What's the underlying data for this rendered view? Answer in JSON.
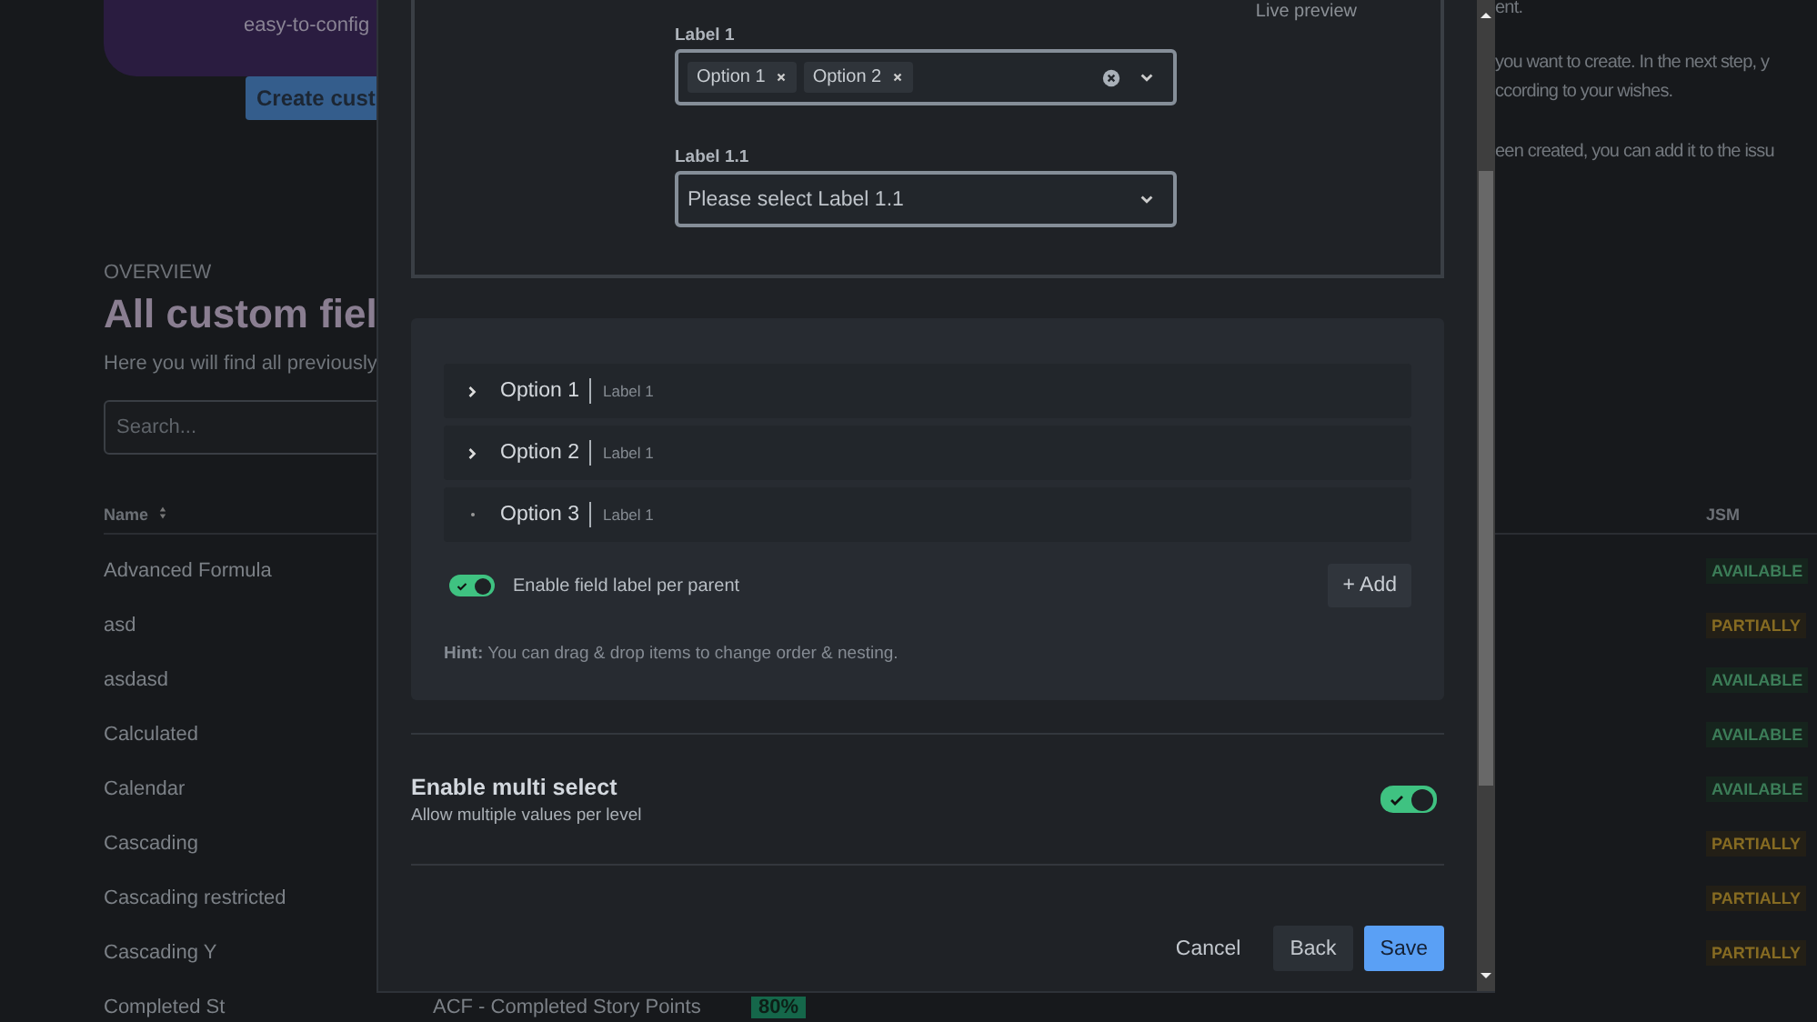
{
  "background": {
    "hero_text": "easy-to-config",
    "create_button": "Create cust",
    "intro_lines": [
      "ent.",
      "you want to create. In the next step, y",
      "ccording to your wishes.",
      "een created, you can add it to the issu"
    ],
    "overview": {
      "eyebrow": "OVERVIEW",
      "title": "All custom fiel",
      "description": "Here you will find all previously",
      "search": {
        "placeholder": "Search..."
      }
    },
    "table": {
      "columns": [
        {
          "label": "Name",
          "sortable": true
        },
        {
          "label": "JSM",
          "sortable": false
        }
      ],
      "rows": [
        {
          "name": "Advanced Formula",
          "jsm": {
            "label": "AVAILABLE",
            "kind": "available"
          }
        },
        {
          "name": "asd",
          "jsm": {
            "label": "PARTIALLY",
            "kind": "partial"
          }
        },
        {
          "name": "asdasd",
          "jsm": {
            "label": "AVAILABLE",
            "kind": "available"
          }
        },
        {
          "name": "Calculated",
          "jsm": {
            "label": "AVAILABLE",
            "kind": "available"
          }
        },
        {
          "name": "Calendar",
          "jsm": {
            "label": "AVAILABLE",
            "kind": "available"
          }
        },
        {
          "name": "Cascading",
          "jsm": {
            "label": "PARTIALLY",
            "kind": "partial"
          }
        },
        {
          "name": "Cascading restricted",
          "jsm": {
            "label": "PARTIALLY",
            "kind": "partial"
          }
        },
        {
          "name": "Cascading Y",
          "jsm": {
            "label": "PARTIALLY",
            "kind": "partial"
          }
        },
        {
          "name": "Completed St",
          "column_2": "ACF - Completed Story Points",
          "column_3": "80%"
        }
      ]
    }
  },
  "modal": {
    "live_preview": "Live preview",
    "fields": [
      {
        "label": "Label 1",
        "kind": "multi",
        "chips": [
          "Option 1",
          "Option 2"
        ]
      },
      {
        "label": "Label 1.1",
        "kind": "single",
        "placeholder": "Please select Label 1.1"
      }
    ],
    "tree": {
      "items": [
        {
          "label": "Option 1",
          "tag": "Label 1",
          "expandable": true
        },
        {
          "label": "Option 2",
          "tag": "Label 1",
          "expandable": true
        },
        {
          "label": "Option 3",
          "tag": "Label 1",
          "expandable": false
        }
      ],
      "toggle": {
        "label": "Enable field label per parent",
        "on": true
      },
      "add_button": "+ Add",
      "hint": "**Hint:** You can drag & drop items to change order & nesting."
    },
    "setting": {
      "title": "Enable multi select",
      "description": "Allow multiple values per level",
      "on": true
    },
    "buttons": [
      {
        "label": "Cancel",
        "kind": "subtle"
      },
      {
        "label": "Back",
        "kind": "default"
      },
      {
        "label": "Save",
        "kind": "primary"
      }
    ]
  }
}
